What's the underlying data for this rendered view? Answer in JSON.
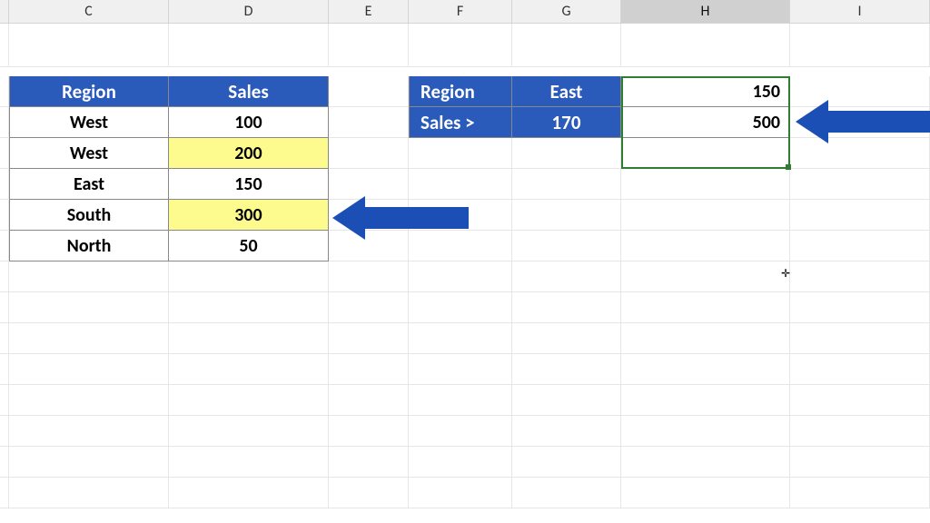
{
  "columns": [
    "C",
    "D",
    "E",
    "F",
    "G",
    "H",
    "I"
  ],
  "selectedColumn": "H",
  "table": {
    "headers": {
      "region": "Region",
      "sales": "Sales"
    },
    "rows": [
      {
        "region": "West",
        "sales": "100",
        "highlight": false
      },
      {
        "region": "West",
        "sales": "200",
        "highlight": true
      },
      {
        "region": "East",
        "sales": "150",
        "highlight": false
      },
      {
        "region": "South",
        "sales": "300",
        "highlight": true
      },
      {
        "region": "North",
        "sales": "50",
        "highlight": false
      }
    ]
  },
  "criteria": {
    "row1": {
      "label": "Region",
      "value": "East",
      "result": "150"
    },
    "row2": {
      "label": "Sales >",
      "value": "170",
      "result": "500"
    }
  },
  "colors": {
    "headerBlue": "#2a5aba",
    "highlightYellow": "#fdfb8e",
    "arrowBlue": "#1c4fb5"
  }
}
